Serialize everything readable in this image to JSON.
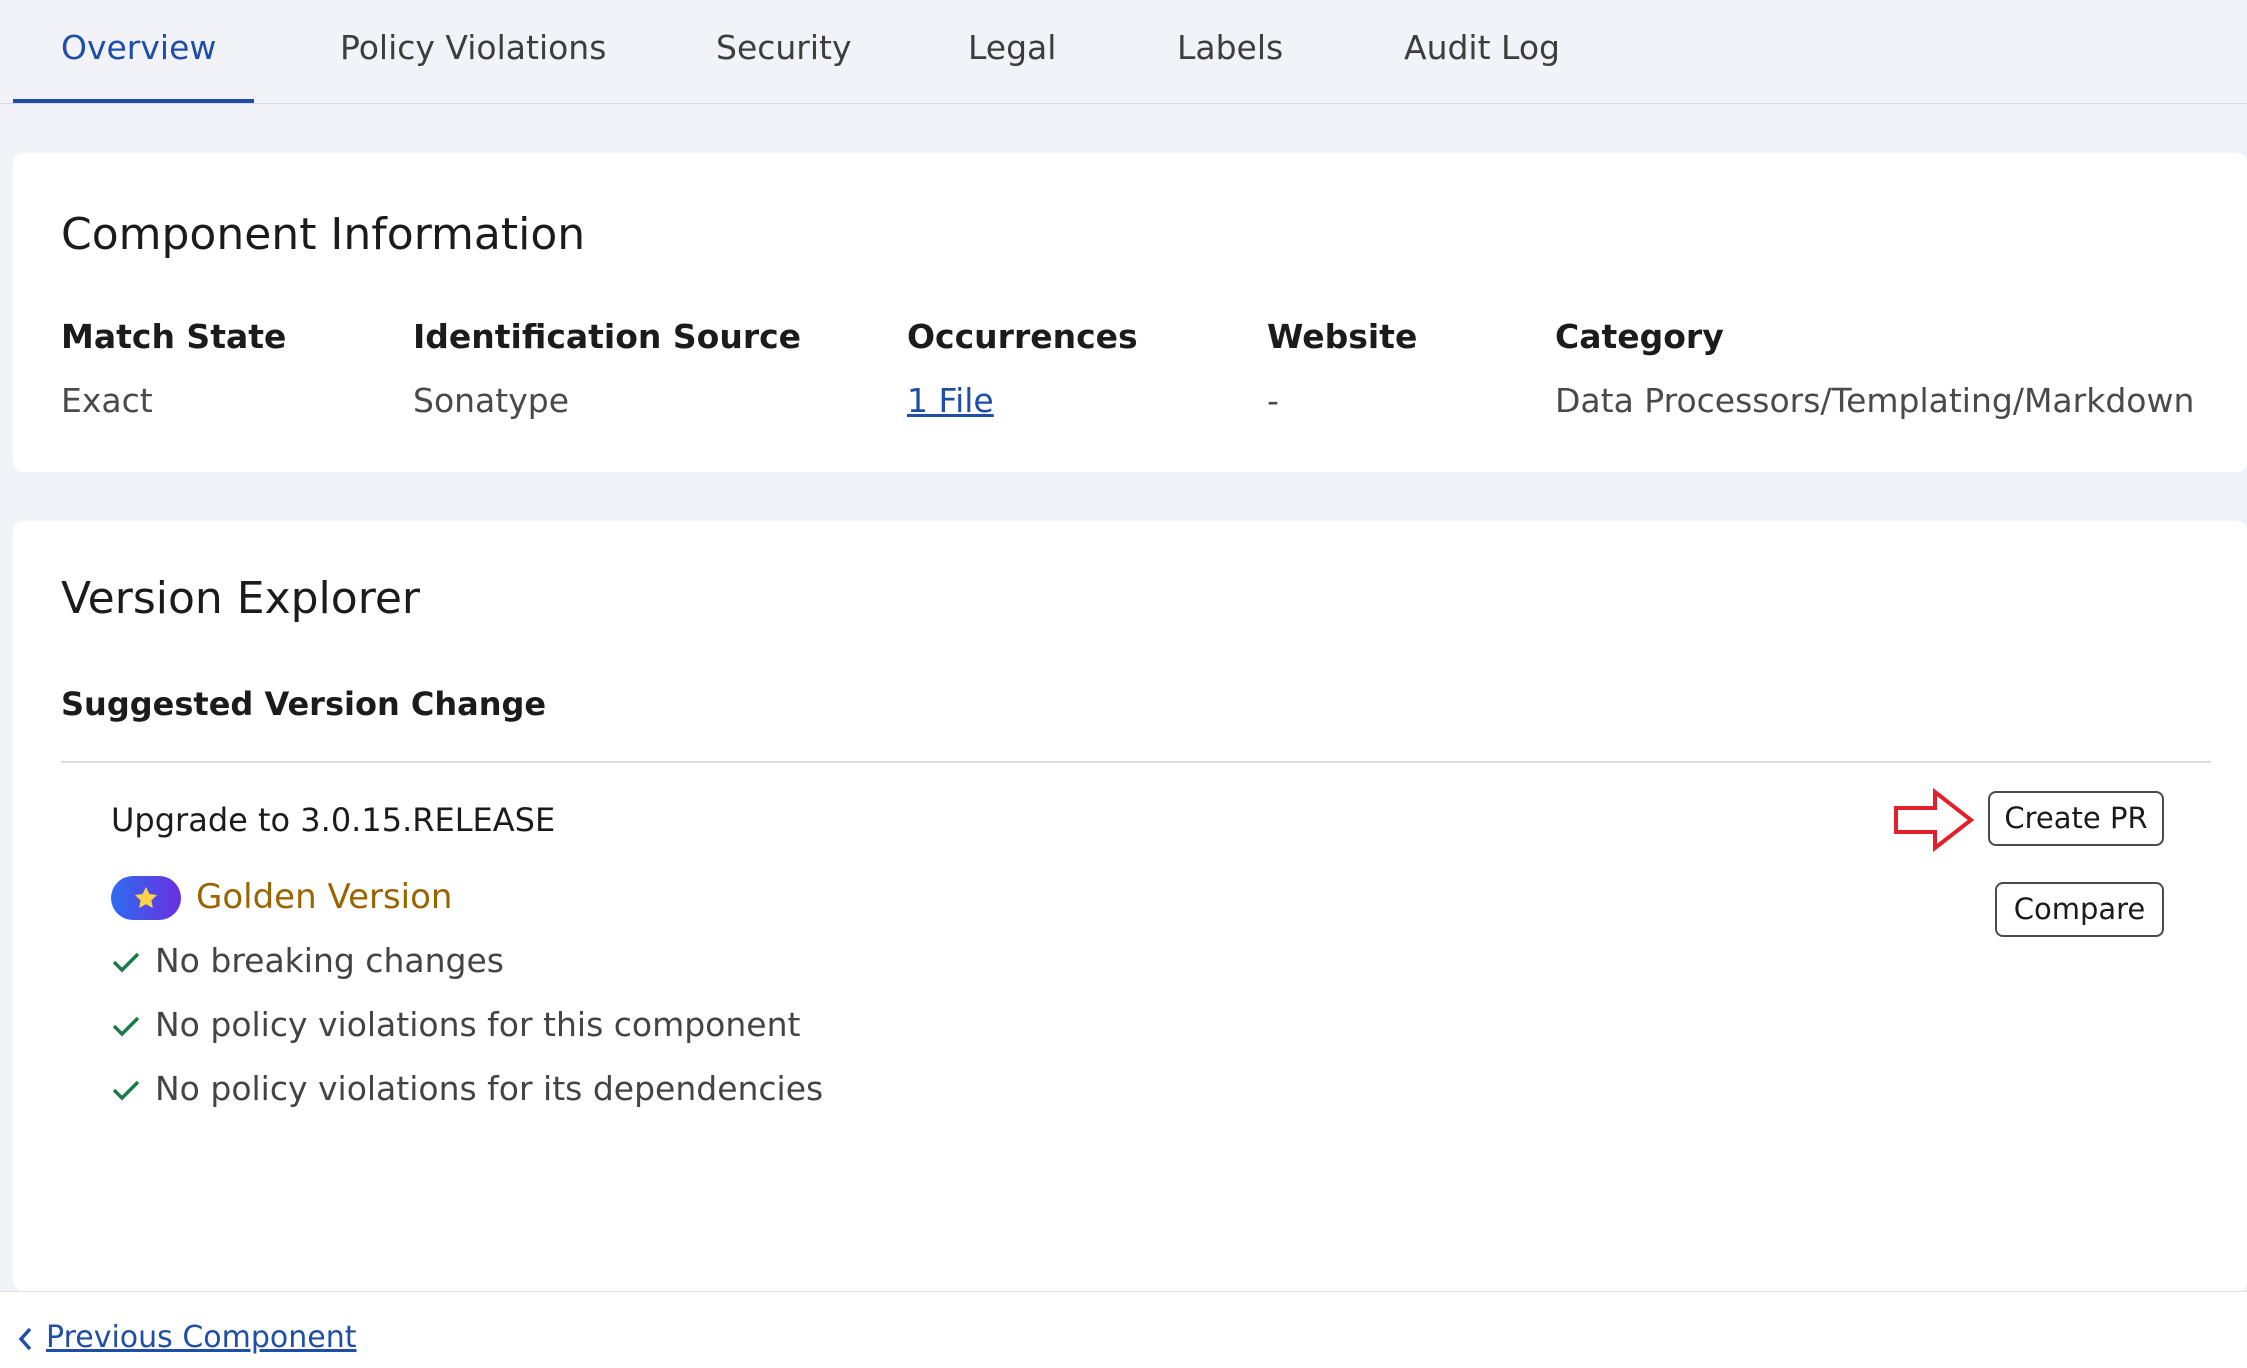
{
  "tabs": [
    {
      "label": "Overview",
      "active": true
    },
    {
      "label": "Policy Violations",
      "active": false
    },
    {
      "label": "Security",
      "active": false
    },
    {
      "label": "Legal",
      "active": false
    },
    {
      "label": "Labels",
      "active": false
    },
    {
      "label": "Audit Log",
      "active": false
    }
  ],
  "component_info": {
    "title": "Component Information",
    "fields": [
      {
        "label": "Match State",
        "value": "Exact"
      },
      {
        "label": "Identification Source",
        "value": "Sonatype"
      },
      {
        "label": "Occurrences",
        "value": "1 File"
      },
      {
        "label": "Website",
        "value": "-"
      },
      {
        "label": "Category",
        "value": "Data Processors/Templating/Markdown"
      }
    ]
  },
  "version_explorer": {
    "title": "Version Explorer",
    "subheading": "Suggested Version Change",
    "upgrade_label": "Upgrade to 3.0.15.RELEASE",
    "golden_label": "Golden Version",
    "checks": [
      "No breaking changes",
      "No policy violations for this component",
      "No policy violations for its dependencies"
    ],
    "create_pr_label": "Create PR",
    "compare_label": "Compare"
  },
  "footer": {
    "previous_label": "Previous Component"
  },
  "colors": {
    "accent": "#1f4ea8",
    "golden": "#9a6500",
    "check": "#1a7a4c",
    "annotation_arrow": "#e0202a"
  },
  "icons": [
    "star-icon",
    "check-icon",
    "chevron-left-icon",
    "arrow-right-icon"
  ]
}
